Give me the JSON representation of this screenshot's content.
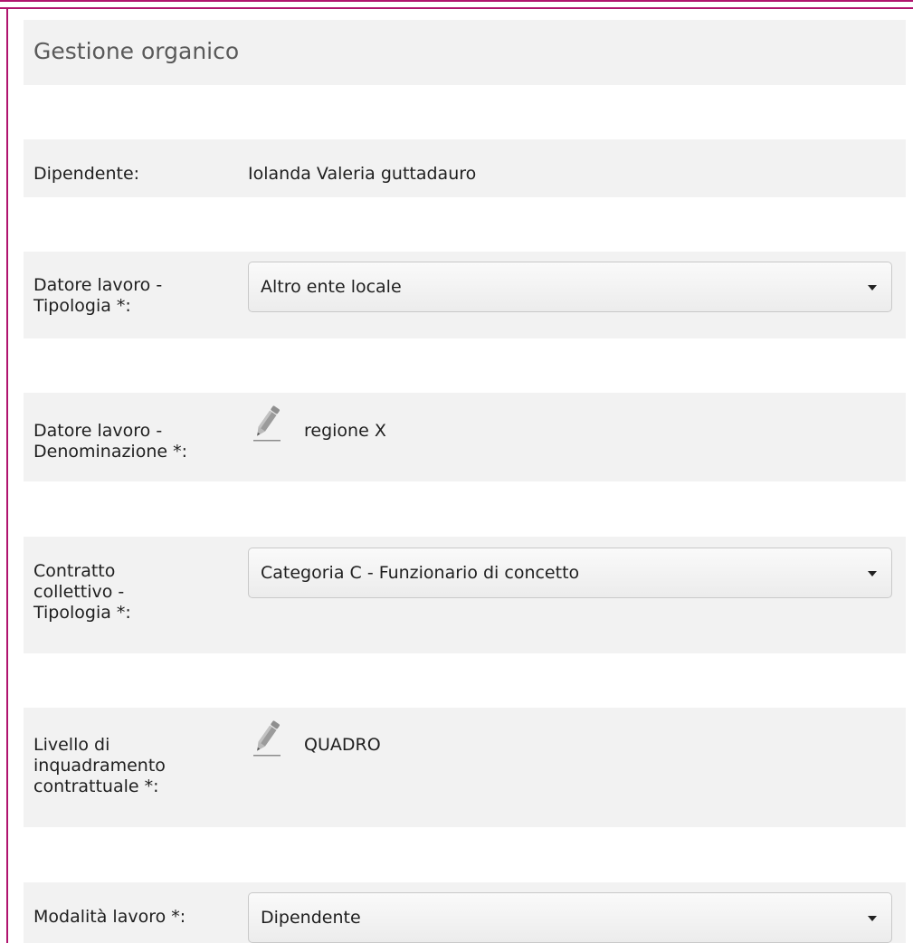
{
  "form": {
    "title": "Gestione organico",
    "employee": {
      "label": "Dipendente:",
      "value": "Iolanda Valeria guttadauro"
    },
    "employer_type": {
      "label": "Datore lavoro -\nTipologia *:",
      "selected": "Altro ente locale"
    },
    "employer_name": {
      "label": "Datore lavoro -\nDenominazione *:",
      "value": "regione X"
    },
    "contract_type": {
      "label": "Contratto\ncollettivo -\nTipologia *:",
      "selected": "Categoria C - Funzionario di concetto"
    },
    "contract_level": {
      "label": "Livello di\ninquadramento\ncontrattuale *:",
      "value": "QUADRO"
    },
    "work_mode": {
      "label": "Modalità lavoro *:",
      "selected": "Dipendente"
    }
  },
  "icons": {
    "edit": "pencil-icon",
    "dropdown": "chevron-down-icon"
  },
  "colors": {
    "frame_border": "#b0146e",
    "panel_background": "#f2f2f2"
  }
}
